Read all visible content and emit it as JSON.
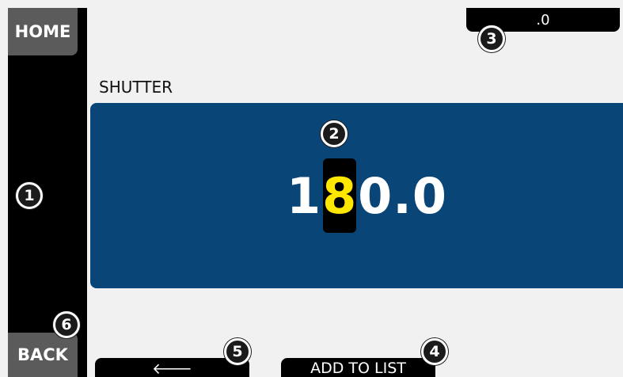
{
  "sidebar": {
    "home_label": "HOME",
    "back_label": "BACK"
  },
  "top_field": {
    "value": ".0"
  },
  "parameter": {
    "label": "SHUTTER",
    "value_prefix": "1",
    "value_cursor_digit": "8",
    "value_suffix": "0.0"
  },
  "bottom_bar": {
    "back_arrow": "🡐",
    "add_to_list_label": "ADD TO LIST"
  },
  "callouts": [
    "1",
    "2",
    "3",
    "4",
    "5",
    "6"
  ],
  "colors": {
    "panel": "#0a4577",
    "cursor_digit": "#ffe800",
    "background": "#f1f1f1",
    "button": "#5b5b5b"
  }
}
